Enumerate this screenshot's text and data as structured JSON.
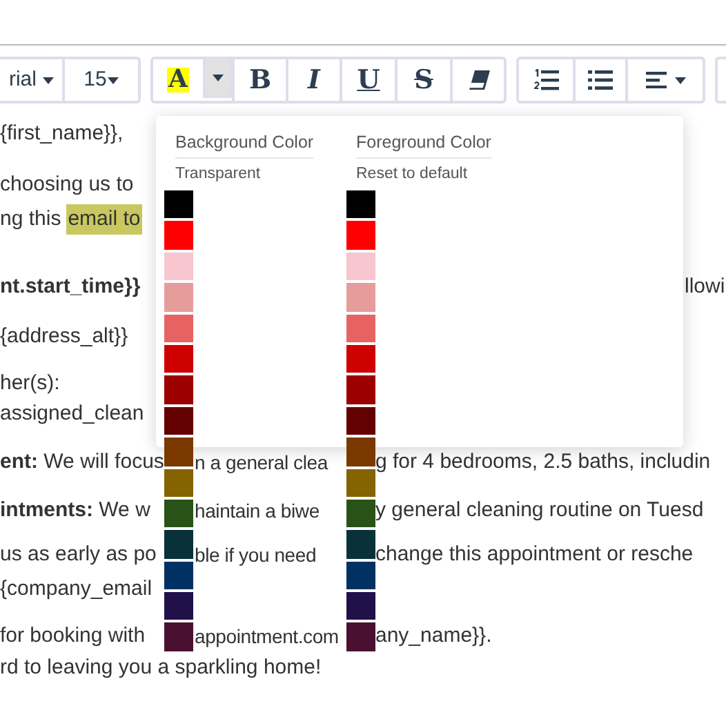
{
  "toolbar": {
    "groups": [
      {
        "items": [
          {
            "kind": "dropdown",
            "label": "rial"
          },
          {
            "kind": "dropdown",
            "label": "15"
          }
        ]
      },
      {
        "items": [
          {
            "kind": "highlight",
            "label": "A"
          },
          {
            "kind": "caret",
            "pressed": true
          },
          {
            "kind": "bold",
            "label": "B"
          },
          {
            "kind": "italic",
            "label": "I"
          },
          {
            "kind": "underline",
            "label": "U"
          },
          {
            "kind": "strike",
            "label": "S"
          },
          {
            "kind": "eraser"
          }
        ]
      },
      {
        "items": [
          {
            "kind": "ordered_list"
          },
          {
            "kind": "bullet_list"
          },
          {
            "kind": "align"
          }
        ]
      }
    ]
  },
  "editor": {
    "lines": [
      {
        "before_popup": "{first_name}},"
      },
      {
        "before_popup": "choosing us to"
      },
      {
        "before_popup": "ng this",
        "highlighted_text": "email to"
      },
      {
        "before_popup": "**nt.start_time}}**",
        "after_popup": "llowi"
      },
      {
        "before_popup": "{address_alt}}"
      },
      {
        "before_popup": "her(s):"
      },
      {
        "before_popup": "assigned_clean"
      },
      {
        "before_popup": "**ent:** We will focus",
        "between_swatches": "n a general clea",
        "after_swatches": "g for 4 bedrooms, 2.5 baths, includin"
      },
      {
        "before_popup": "**intments:** We w",
        "between_swatches": "haintain a biwe",
        "after_swatches": "y general cleaning routine on Tuesd"
      },
      {
        "before_popup": "us as early as po",
        "between_swatches": "ble if you need",
        "after_swatches": "change this appointment or resche"
      },
      {
        "before_popup": "{company_email"
      },
      {
        "before_popup": "for booking with",
        "between_swatches": "appointment.com",
        "after_swatches": "any_name}}."
      },
      {
        "full_line": "rd to leaving you a sparkling home!"
      }
    ]
  },
  "color_popup": {
    "columns": [
      {
        "heading": "Background Color",
        "reset": "Transparent",
        "swatches": [
          {
            "color": "#000000"
          },
          {
            "color": "#ff0000"
          },
          {
            "color": "#f7c6ce"
          },
          {
            "color": "#e79c9c"
          },
          {
            "color": "#e76363"
          },
          {
            "color": "#ce0000"
          },
          {
            "color": "#9c0000"
          },
          {
            "color": "#630000"
          },
          {
            "color": "#7b3900"
          },
          {
            "color": "#846300"
          },
          {
            "color": "#295218"
          },
          {
            "color": "#083139"
          },
          {
            "color": "#003163"
          },
          {
            "color": "#21104a"
          },
          {
            "color": "#4a1031"
          }
        ]
      },
      {
        "heading": "Foreground Color",
        "reset": "Reset to default",
        "swatches": [
          {
            "color": "#000000"
          },
          {
            "color": "#ff0000"
          },
          {
            "color": "#f7c6ce"
          },
          {
            "color": "#e79c9c"
          },
          {
            "color": "#e76363"
          },
          {
            "color": "#ce0000"
          },
          {
            "color": "#9c0000"
          },
          {
            "color": "#630000"
          },
          {
            "color": "#7b3900"
          },
          {
            "color": "#846300"
          },
          {
            "color": "#295218"
          },
          {
            "color": "#083139"
          },
          {
            "color": "#003163"
          },
          {
            "color": "#21104a"
          },
          {
            "color": "#4a1031"
          }
        ]
      }
    ]
  }
}
